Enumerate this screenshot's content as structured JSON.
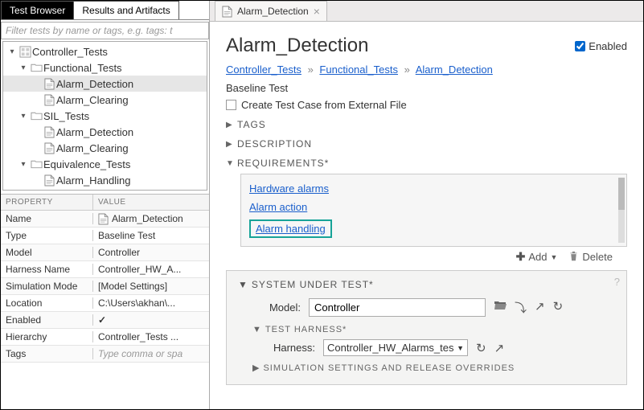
{
  "leftTabs": {
    "browser": "Test Browser",
    "results": "Results and Artifacts"
  },
  "filter": {
    "placeholder": "Filter tests by name or tags, e.g. tags: t"
  },
  "tree": {
    "root": "Controller_Tests",
    "n1": "Functional_Tests",
    "n1a": "Alarm_Detection",
    "n1b": "Alarm_Clearing",
    "n2": "SIL_Tests",
    "n2a": "Alarm_Detection",
    "n2b": "Alarm_Clearing",
    "n3": "Equivalence_Tests",
    "n3a": "Alarm_Handling"
  },
  "propHeaders": {
    "c1": "PROPERTY",
    "c2": "VALUE"
  },
  "props": {
    "name_k": "Name",
    "name_v": "Alarm_Detection",
    "type_k": "Type",
    "type_v": "Baseline Test",
    "model_k": "Model",
    "model_v": "Controller",
    "harness_k": "Harness Name",
    "harness_v": "Controller_HW_A...",
    "sim_k": "Simulation Mode",
    "sim_v": "[Model Settings]",
    "loc_k": "Location",
    "loc_v": "C:\\Users\\akhan\\...",
    "enabled_k": "Enabled",
    "hier_k": "Hierarchy",
    "hier_v": "Controller_Tests ...",
    "tags_k": "Tags",
    "tags_ph": "Type comma or spa"
  },
  "editorTab": "Alarm_Detection",
  "page": {
    "title": "Alarm_Detection",
    "enabledLabel": "Enabled",
    "crumb1": "Controller_Tests",
    "crumb2": "Functional_Tests",
    "crumb3": "Alarm_Detection",
    "subtitle": "Baseline Test",
    "createExternal": "Create Test Case from External File"
  },
  "sections": {
    "tags": "TAGS",
    "desc": "DESCRIPTION",
    "req": "REQUIREMENTS*",
    "sut": "SYSTEM UNDER TEST*",
    "th": "TEST HARNESS*",
    "simset": "SIMULATION SETTINGS AND RELEASE OVERRIDES"
  },
  "requirements": {
    "r1": "Hardware alarms",
    "r2": "Alarm action",
    "r3": "Alarm handling"
  },
  "reqActions": {
    "add": "Add",
    "delete": "Delete"
  },
  "sut": {
    "modelLabel": "Model:",
    "modelValue": "Controller",
    "harnessLabel": "Harness:",
    "harnessValue": "Controller_HW_Alarms_tes"
  }
}
